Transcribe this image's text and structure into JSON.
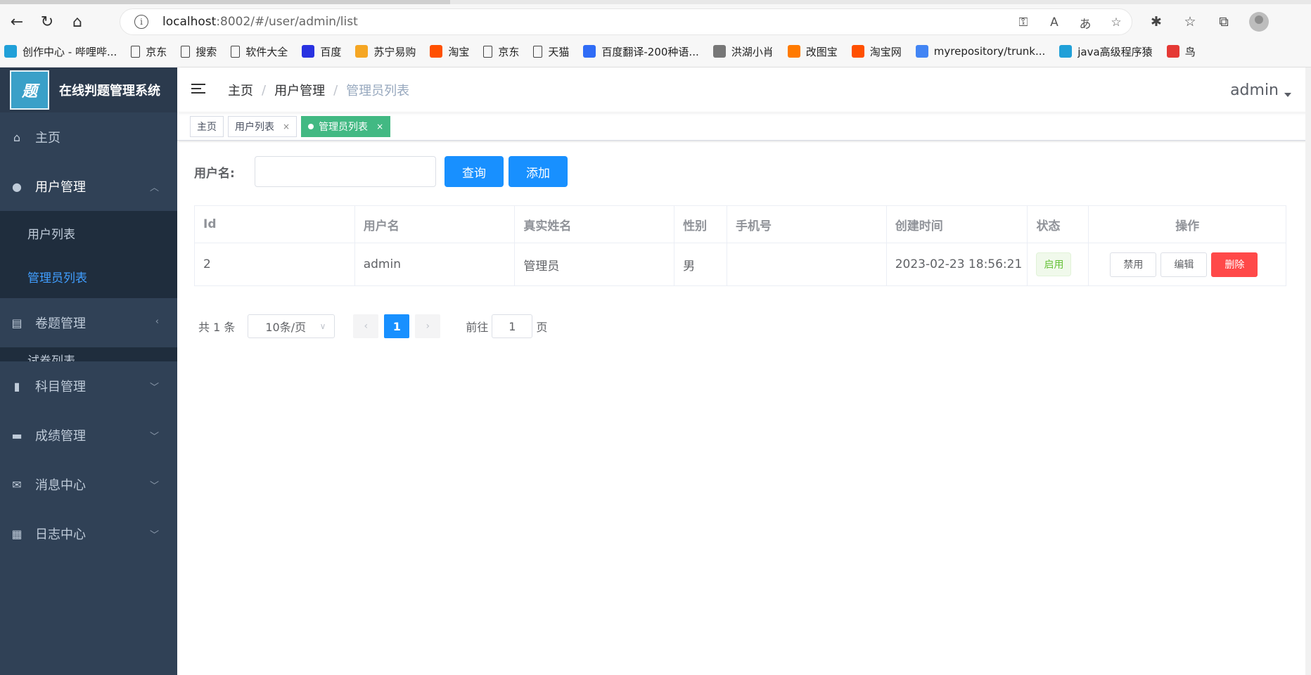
{
  "browser": {
    "url_host": "localhost",
    "url_rest": ":8002/#/user/admin/list",
    "bookmarks": [
      {
        "label": "创作中心 - 哔哩哔...",
        "icon": "bilibili-icon",
        "color": "#20a0d8"
      },
      {
        "label": "京东",
        "icon": "page-icon",
        "color": ""
      },
      {
        "label": "搜索",
        "icon": "page-icon",
        "color": ""
      },
      {
        "label": "软件大全",
        "icon": "page-icon",
        "color": ""
      },
      {
        "label": "百度",
        "icon": "baidu-icon",
        "color": "#2932e1"
      },
      {
        "label": "苏宁易购",
        "icon": "suning-icon",
        "color": "#f5a623"
      },
      {
        "label": "淘宝",
        "icon": "taobao-icon",
        "color": "#ff5000"
      },
      {
        "label": "京东",
        "icon": "page-icon",
        "color": ""
      },
      {
        "label": "天猫",
        "icon": "page-icon",
        "color": ""
      },
      {
        "label": "百度翻译-200种语...",
        "icon": "translate-icon",
        "color": "#2f6cf6"
      },
      {
        "label": "洪湖小肖",
        "icon": "bird-icon",
        "color": "#777"
      },
      {
        "label": "改图宝",
        "icon": "gaitubao-icon",
        "color": "#ff7a00"
      },
      {
        "label": "淘宝网",
        "icon": "taobao-icon",
        "color": "#ff5000"
      },
      {
        "label": "myrepository/trunk...",
        "icon": "chrome-icon",
        "color": "#4285f4"
      },
      {
        "label": "java高级程序猿",
        "icon": "bilibili-icon",
        "color": "#20a0d8"
      },
      {
        "label": "鸟",
        "icon": "swallow-icon",
        "color": "#e53935"
      }
    ]
  },
  "sidebar": {
    "logo_text": "题",
    "title": "在线判题管理系统",
    "items": [
      {
        "label": "主页",
        "icon": "home-icon"
      },
      {
        "label": "用户管理",
        "icon": "user-icon"
      },
      {
        "label": "卷题管理",
        "icon": "book-icon"
      },
      {
        "label": "科目管理",
        "icon": "subject-icon"
      },
      {
        "label": "成绩管理",
        "icon": "message-icon"
      },
      {
        "label": "消息中心",
        "icon": "mail-icon"
      },
      {
        "label": "日志中心",
        "icon": "log-icon"
      }
    ],
    "user_sub": [
      "用户列表",
      "管理员列表"
    ],
    "exam_sub_partial": "试卷列表"
  },
  "navbar": {
    "breadcrumb": [
      "主页",
      "用户管理",
      "管理员列表"
    ],
    "user": "admin"
  },
  "tags": [
    {
      "label": "主页"
    },
    {
      "label": "用户列表"
    },
    {
      "label": "管理员列表"
    }
  ],
  "search": {
    "label": "用户名:",
    "value": "",
    "query_btn": "查询",
    "add_btn": "添加"
  },
  "table": {
    "columns": [
      "Id",
      "用户名",
      "真实姓名",
      "性别",
      "手机号",
      "创建时间",
      "状态",
      "操作"
    ],
    "rows": [
      {
        "id": "2",
        "username": "admin",
        "realname": "管理员",
        "gender": "男",
        "phone": "",
        "created": "2023-02-23 18:56:21",
        "status": "启用",
        "actions": [
          "禁用",
          "编辑",
          "删除"
        ]
      }
    ]
  },
  "pagination": {
    "total": "共 1 条",
    "page_size": "10条/页",
    "current": "1",
    "goto_prefix": "前往",
    "goto_value": "1",
    "goto_suffix": "页"
  },
  "colors": {
    "sidebar": "#304156",
    "primary": "#1890ff",
    "active_tag": "#42b983",
    "danger": "#ff4949"
  }
}
